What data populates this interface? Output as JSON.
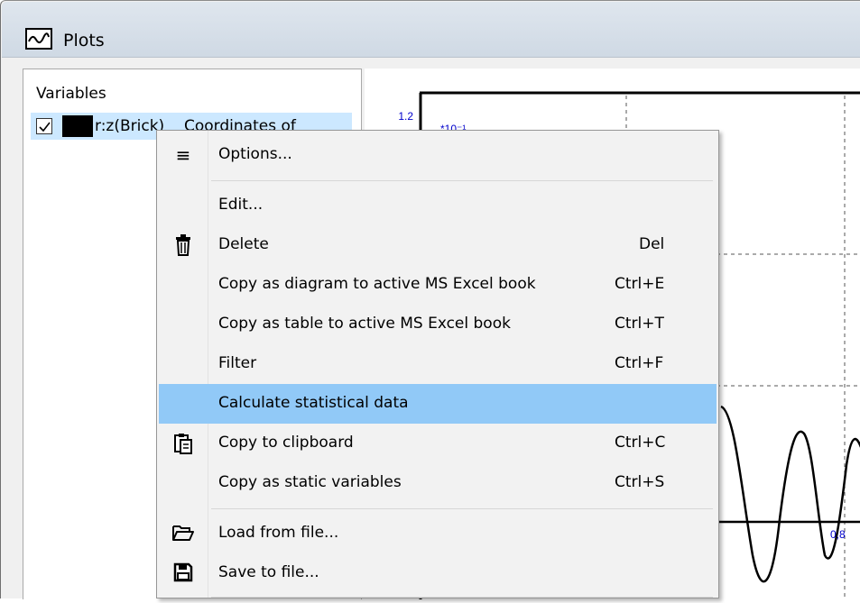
{
  "window": {
    "title": "Plots"
  },
  "variables_panel": {
    "header": "Variables",
    "row": {
      "checked": true,
      "swatch_color": "#000000",
      "name": "r:z(Brick)",
      "description": "Coordinates of"
    }
  },
  "plot": {
    "y_tick_top": "1.2",
    "y_multiplier": "*10⁻¹",
    "x_tick": "0,8",
    "tick_color": "#0000cc"
  },
  "context_menu": {
    "items": [
      {
        "icon": "list-icon",
        "label": "Options...",
        "shortcut": ""
      },
      {
        "icon": "",
        "label": "Edit...",
        "shortcut": ""
      },
      {
        "icon": "trash-icon",
        "label": "Delete",
        "shortcut": "Del"
      },
      {
        "icon": "",
        "label": "Copy as diagram to active MS Excel book",
        "shortcut": "Ctrl+E"
      },
      {
        "icon": "",
        "label": "Copy as table to active MS Excel book",
        "shortcut": "Ctrl+T"
      },
      {
        "icon": "",
        "label": "Filter",
        "shortcut": "Ctrl+F"
      },
      {
        "icon": "",
        "label": "Calculate statistical data",
        "shortcut": "",
        "highlighted": true
      },
      {
        "icon": "clipboard-icon",
        "label": "Copy to clipboard",
        "shortcut": "Ctrl+C"
      },
      {
        "icon": "",
        "label": "Copy as static variables",
        "shortcut": "Ctrl+S"
      },
      {
        "icon": "folder-open-icon",
        "label": "Load from file...",
        "shortcut": ""
      },
      {
        "icon": "save-icon",
        "label": "Save to file...",
        "shortcut": ""
      }
    ],
    "highlight_color": "#91c9f7"
  }
}
